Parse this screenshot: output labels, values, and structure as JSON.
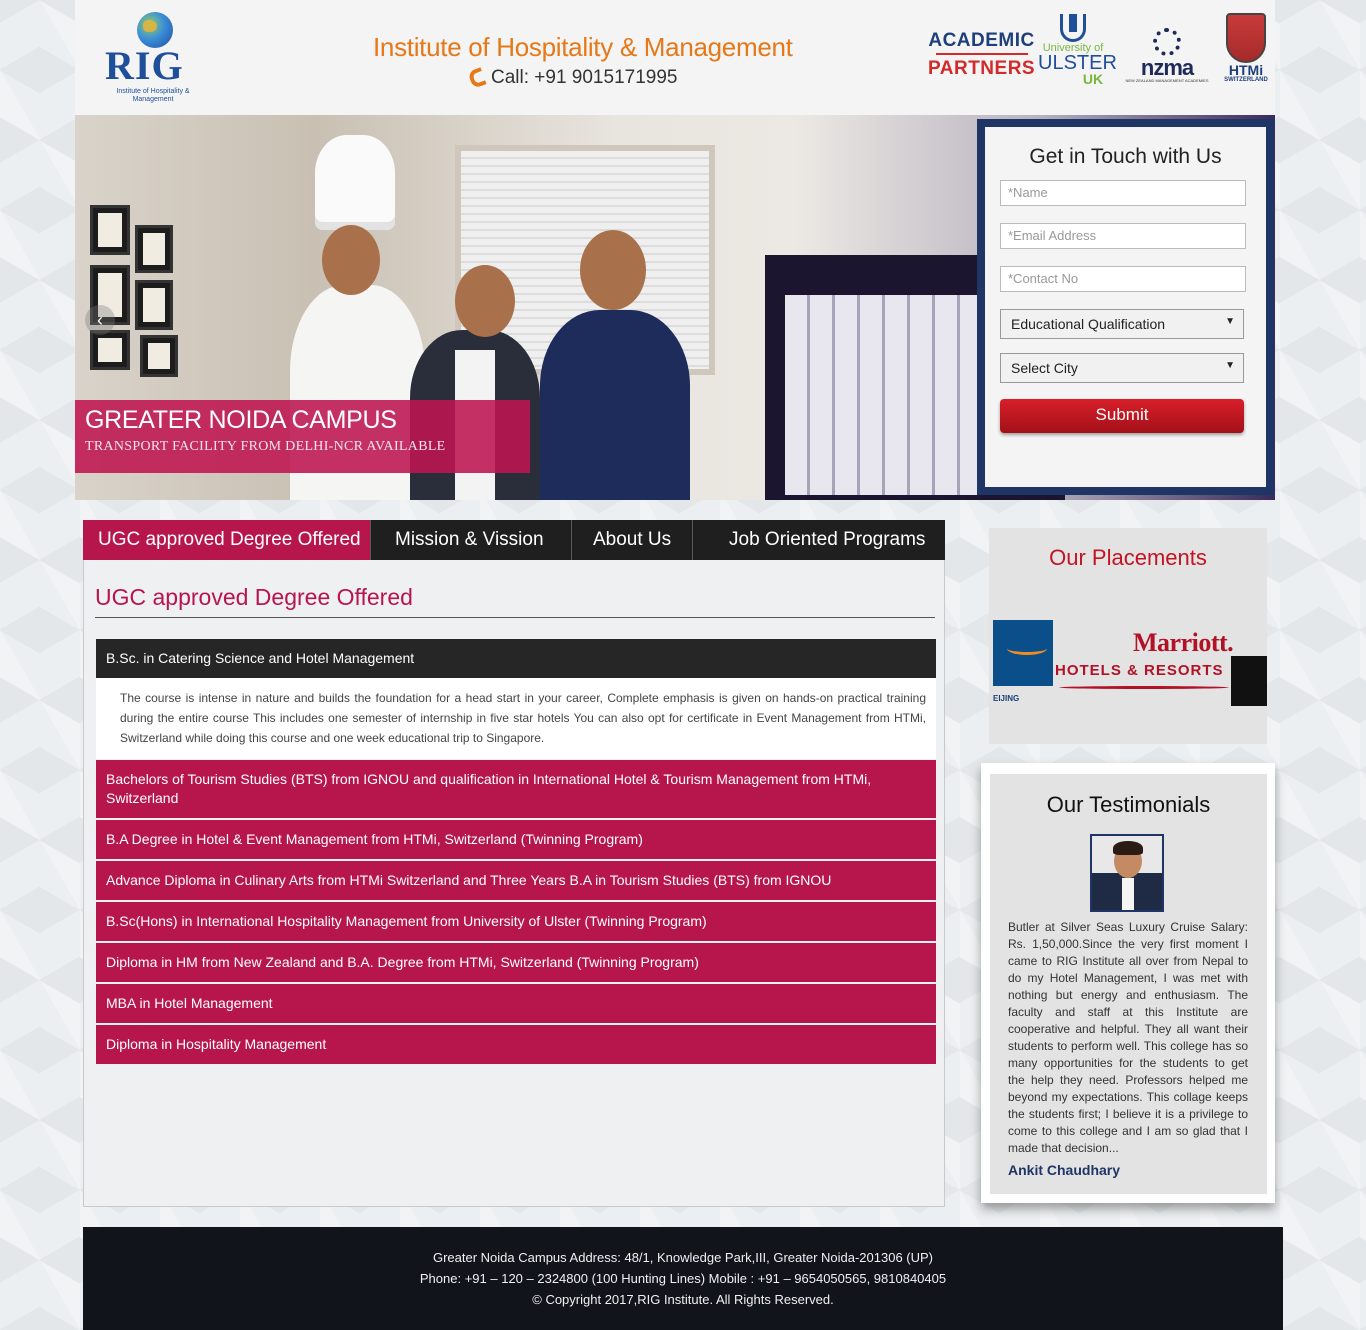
{
  "header": {
    "logo_text": "RIG",
    "logo_sub": "Institute of Hospitality & Management",
    "title": "Institute of Hospitality & Management",
    "call": "Call: +91 9015171995",
    "partners_line1": "ACADEMIC",
    "partners_line2": "PARTNERS",
    "ulster": {
      "l1": "University of",
      "l2": "ULSTER",
      "l3": "UK"
    },
    "nzma": {
      "l1": "nzma",
      "l2": "NEW ZEALAND MANAGEMENT ACADEMIES"
    },
    "htmi": {
      "l1": "HTMi",
      "l2": "SWITZERLAND"
    }
  },
  "hero": {
    "prev_arrow": "‹",
    "next_arrow": "›",
    "caption_title": "GREATER NOIDA CAMPUS",
    "caption_sub": "TRANSPORT FACILITY FROM DELHI-NCR AVAILABLE"
  },
  "contact": {
    "title": "Get in Touch with Us",
    "name_placeholder": "*Name",
    "email_placeholder": "*Email Address",
    "phone_placeholder": "*Contact No",
    "qualification": "Educational Qualification",
    "city": "Select City",
    "submit": "Submit"
  },
  "tabs": [
    {
      "label": "UGC approved Degree Offered",
      "active": true
    },
    {
      "label": "Mission & Vission",
      "active": false
    },
    {
      "label": "About Us",
      "active": false
    },
    {
      "label": "Job Oriented Programs",
      "active": false
    }
  ],
  "content": {
    "heading": "UGC approved Degree Offered",
    "open_item": {
      "title": "B.Sc. in Catering Science and Hotel Management",
      "body": "The course is intense in nature and builds the foundation for a head start in your career, Complete emphasis is given on hands-on practical training during the entire course This includes one semester of internship in five star hotels You can also opt for certificate in Event Management from HTMi, Switzerland while doing this course and one week educational trip to Singapore."
    },
    "items": [
      "Bachelors of Tourism Studies (BTS) from IGNOU and qualification in International Hotel & Tourism Management from HTMi, Switzerland",
      "B.A Degree in Hotel & Event Management from HTMi, Switzerland (Twinning Program)",
      "Advance Diploma in Culinary Arts from HTMi Switzerland and Three Years B.A in Tourism Studies (BTS) from IGNOU",
      "B.Sc(Hons) in International Hospitality Management from University of Ulster (Twinning Program)",
      "Diploma in HM from New Zealand and B.A. Degree from HTMi, Switzerland (Twinning Program)",
      "MBA in Hotel Management",
      "Diploma in Hospitality Management"
    ]
  },
  "placements": {
    "title": "Our Placements",
    "logo1_sub": "EIJING",
    "marriott": "Marriott.",
    "marriott_sub": "HOTELS & RESORTS"
  },
  "testimonials": {
    "title": "Our Testimonials",
    "text": "Butler at Silver Seas Luxury Cruise Salary: Rs. 1,50,000.Since the very first moment I came to RIG Institute all over from Nepal to do my Hotel Management, I was met with nothing but energy and enthusiasm. The faculty and staff at this Institute are cooperative and helpful. They all want their students to perform well. This college has so many opportunities for the students to get the help they need. Professors helped me beyond my expectations. This collage keeps the students first; I believe it is a privilege to come to this college and I am so glad that I made that decision...",
    "author": "Ankit Chaudhary"
  },
  "footer": {
    "line1": "Greater Noida Campus Address: 48/1, Knowledge Park,III, Greater Noida-201306 (UP)",
    "line2": "Phone: +91 – 120 – 2324800 (100 Hunting Lines) Mobile : +91 – 9654050565, 9810840405",
    "line3": "© Copyright 2017,RIG Institute. All Rights Reserved."
  },
  "colors": {
    "brand_magenta": "#b7164d",
    "brand_orange": "#e67817",
    "navy": "#1f3566",
    "submit_red": "#c41424"
  }
}
